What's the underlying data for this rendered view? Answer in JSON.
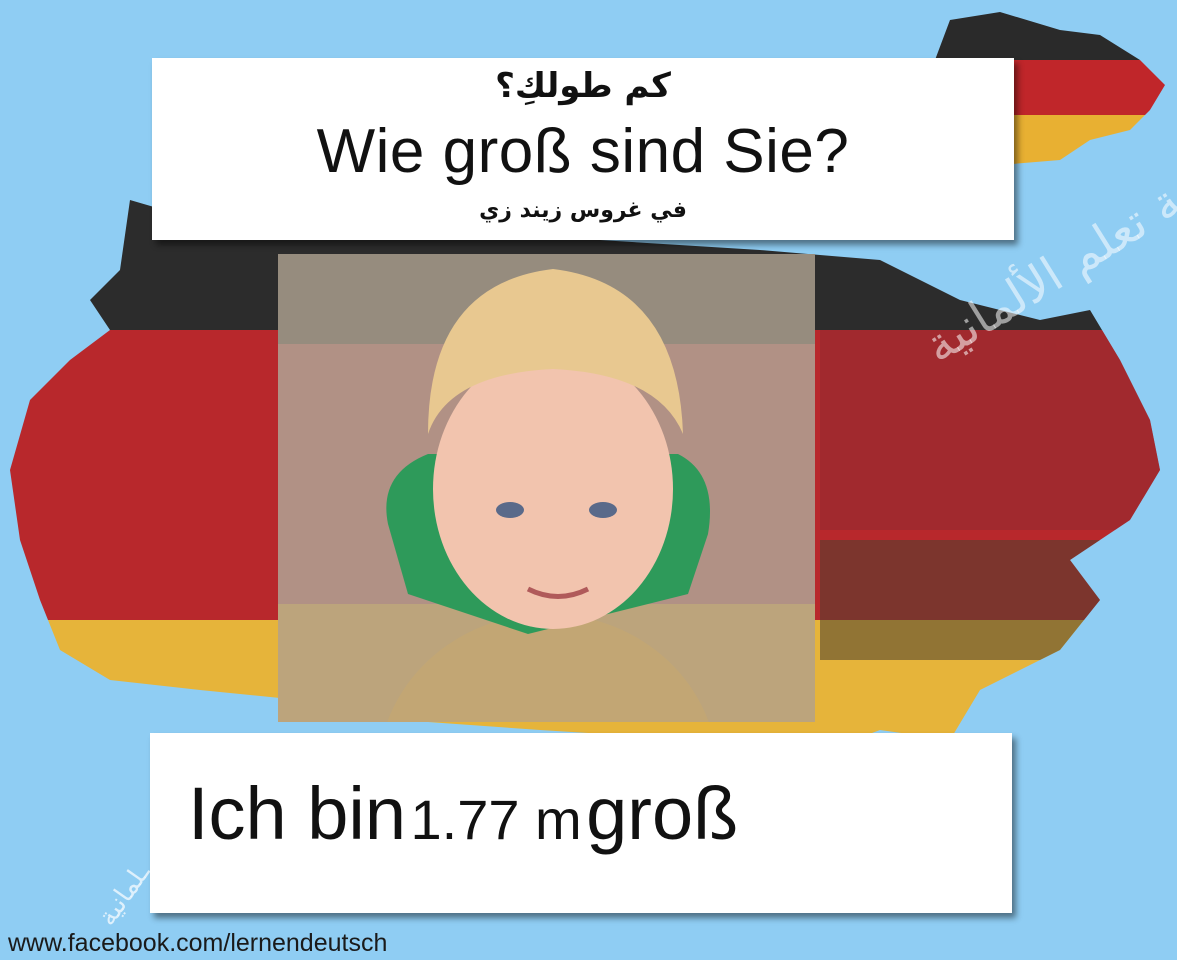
{
  "question": {
    "arabic": "كم طولكِ؟",
    "german": "Wie groß sind Sie?",
    "pronunciation": "في غروس زيند زي"
  },
  "answer": {
    "part1": "Ich bin",
    "value": "1.77 m",
    "part2": "groß"
  },
  "footer": {
    "url": "www.facebook.com/lernendeutsch"
  },
  "watermark": {
    "text": "صفحة تعلم الألمانية",
    "small": "ـلمانية"
  },
  "colors": {
    "background": "#8fcdf3",
    "flag_black": "#2c2c2c",
    "flag_red": "#b8282c",
    "flag_gold": "#e6b43a"
  }
}
